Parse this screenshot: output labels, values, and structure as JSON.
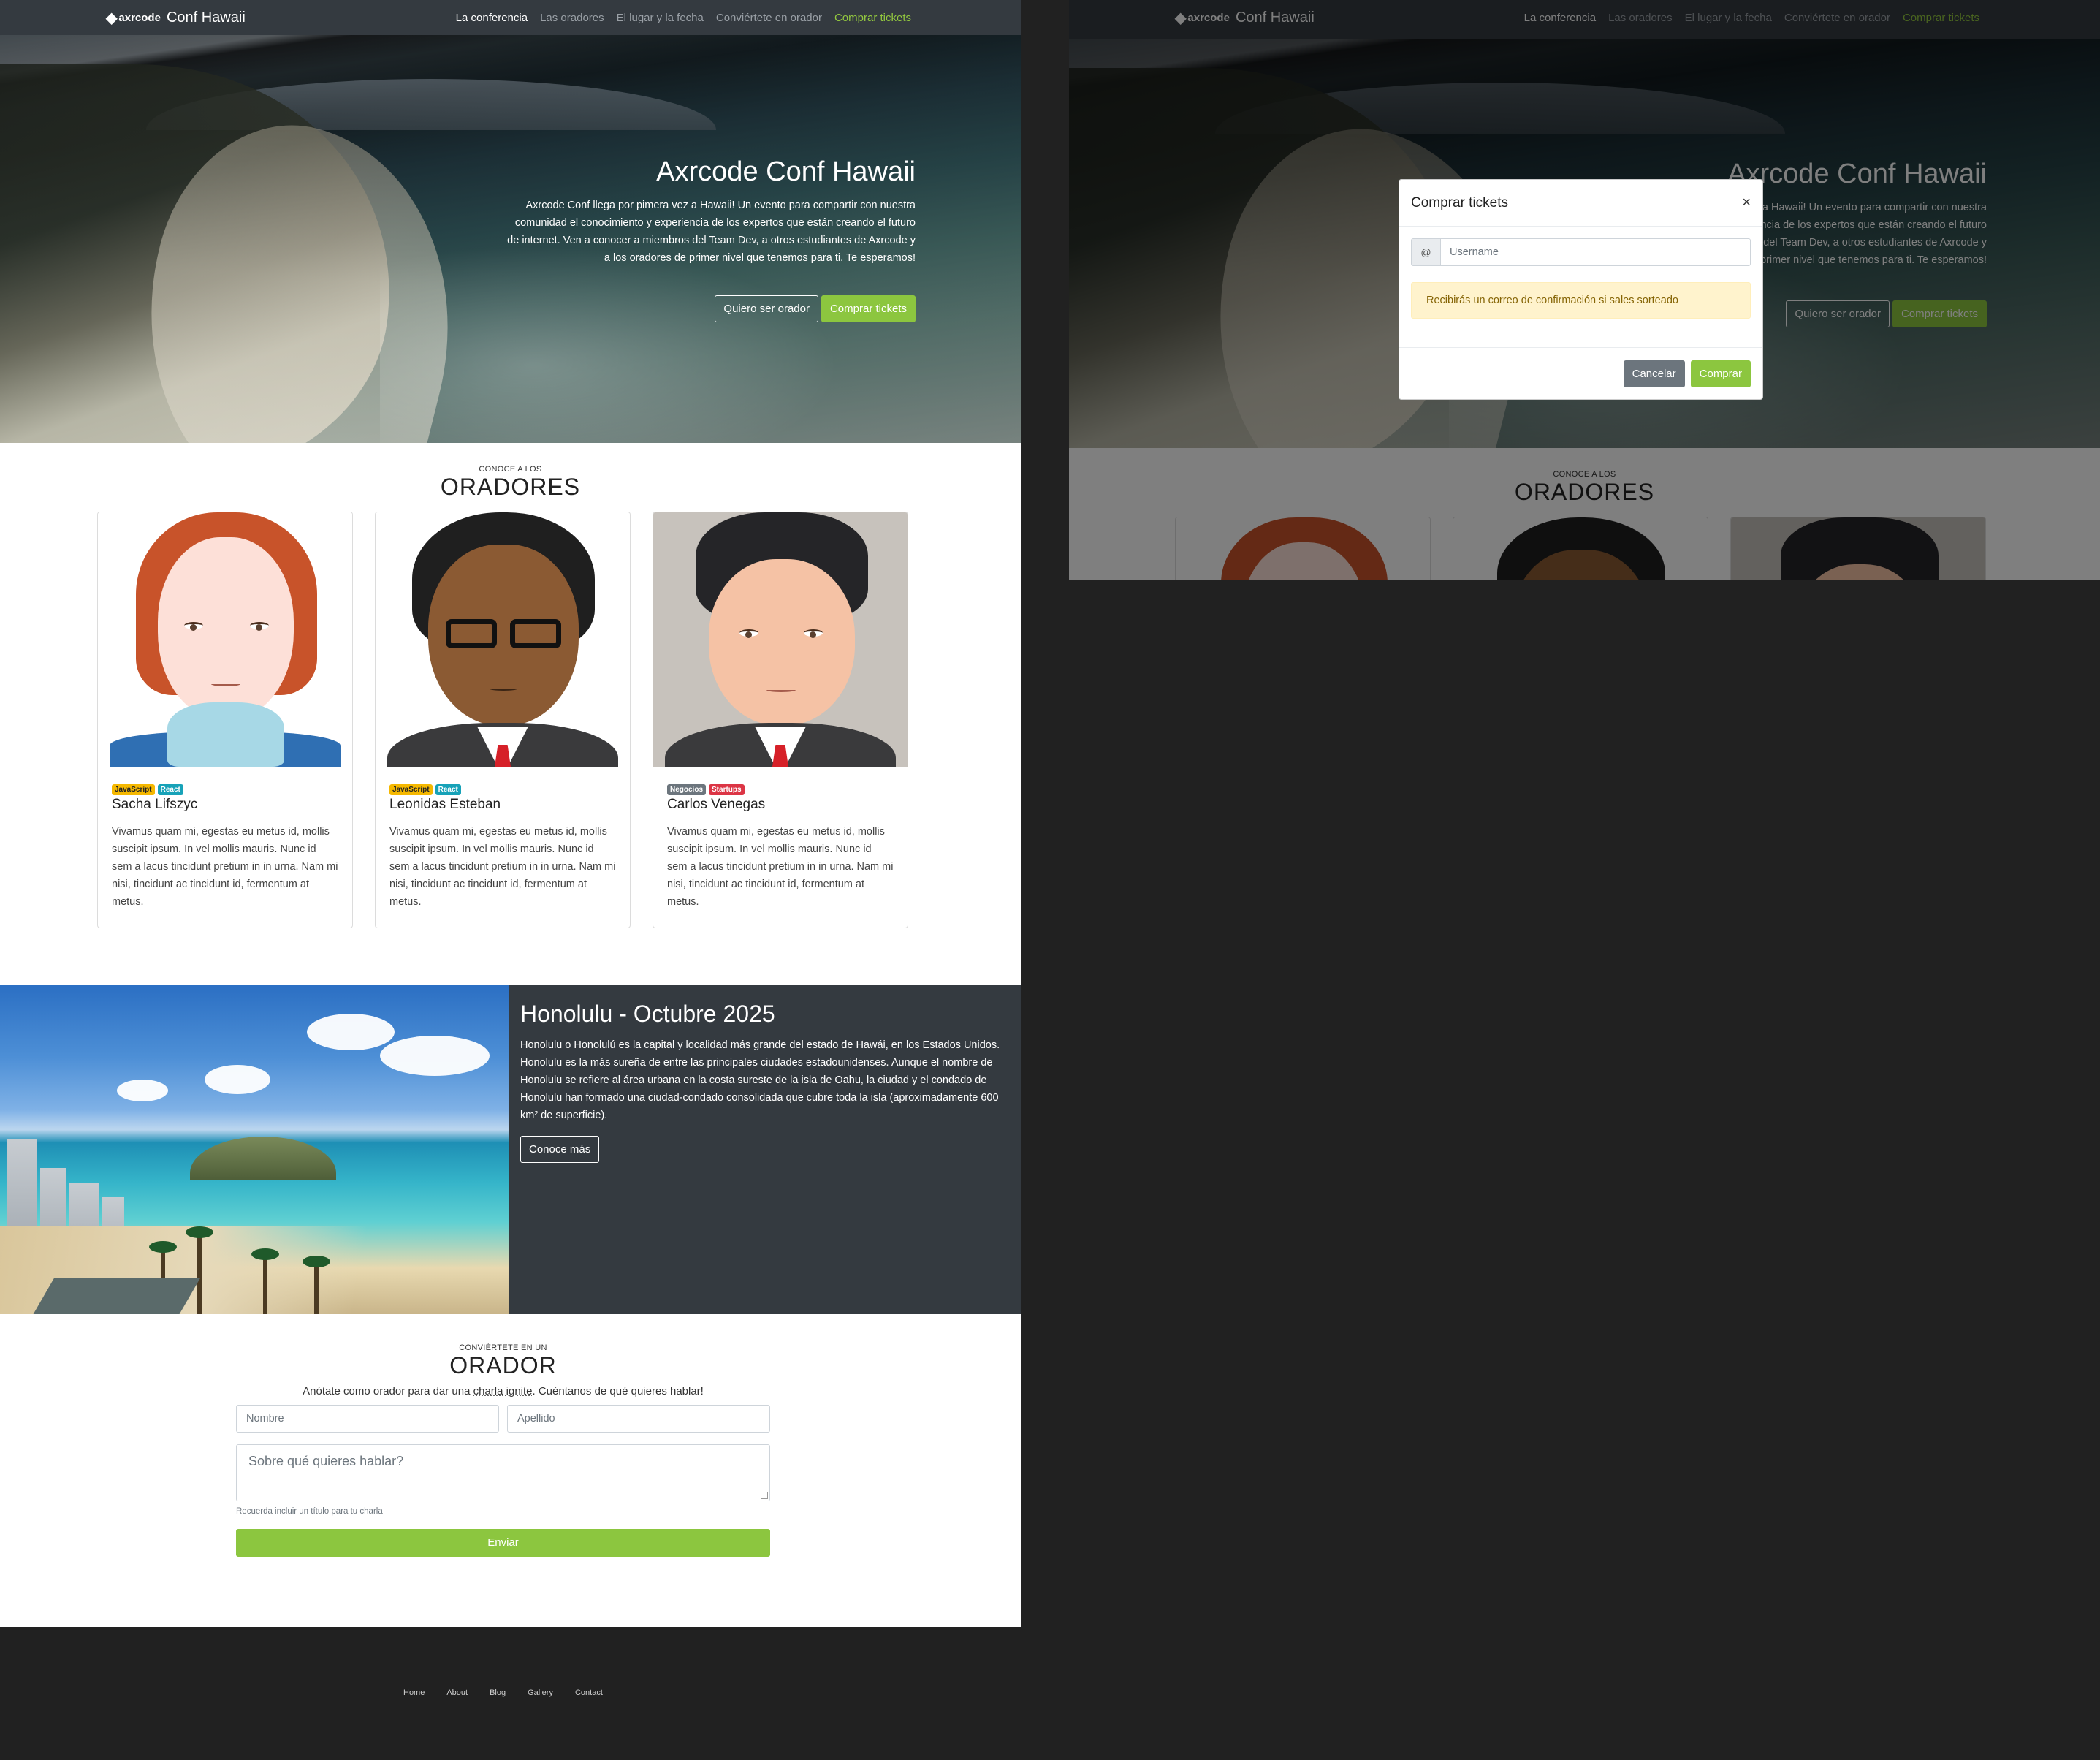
{
  "nav": {
    "brand_logo": "axrcode",
    "brand_title": "Conf Hawaii",
    "links": [
      "La conferencia",
      "Las oradores",
      "El lugar y la fecha",
      "Conviértete en orador",
      "Comprar tickets"
    ]
  },
  "hero": {
    "title": "Axrcode Conf Hawaii",
    "text": "Axrcode Conf llega por pimera vez a Hawaii! Un evento para compartir con nuestra comunidad el conocimiento y experiencia de los expertos que están creando el futuro de internet. Ven a conocer a miembros del Team Dev, a otros estudiantes de Axrcode y a los oradores de primer nivel que tenemos para ti. Te esperamos!",
    "btn_speaker": "Quiero ser orador",
    "btn_tickets": "Comprar tickets"
  },
  "speakers": {
    "kicker": "CONOCE A LOS",
    "title": "ORADORES",
    "cards": [
      {
        "badges": [
          "JavaScript",
          "React"
        ],
        "name": "Sacha Lifszyc",
        "text": "Vivamus quam mi, egestas eu metus id, mollis suscipit ipsum. In vel mollis mauris. Nunc id sem a lacus tincidunt pretium in in urna. Nam mi nisi, tincidunt ac tincidunt id, fermentum at metus."
      },
      {
        "badges": [
          "JavaScript",
          "React"
        ],
        "name": "Leonidas Esteban",
        "text": "Vivamus quam mi, egestas eu metus id, mollis suscipit ipsum. In vel mollis mauris. Nunc id sem a lacus tincidunt pretium in in urna. Nam mi nisi, tincidunt ac tincidunt id, fermentum at metus."
      },
      {
        "badges": [
          "Negocios",
          "Startups"
        ],
        "name": "Carlos Venegas",
        "text": "Vivamus quam mi, egestas eu metus id, mollis suscipit ipsum. In vel mollis mauris. Nunc id sem a lacus tincidunt pretium in in urna. Nam mi nisi, tincidunt ac tincidunt id, fermentum at metus."
      }
    ]
  },
  "venue": {
    "title": "Honolulu - Octubre 2025",
    "text": "Honolulu o Honolulú es la capital y localidad más grande del estado de Hawái, en los Estados Unidos. Honolulu es la más sureña de entre las principales ciudades estadounidenses. Aunque el nombre de Honolulu se refiere al área urbana en la costa sureste de la isla de Oahu, la ciudad y el condado de Honolulu han formado una ciudad-condado consolidada que cubre toda la isla (aproximadamente 600 km² de superficie).",
    "button": "Conoce más"
  },
  "speaker_form": {
    "kicker": "CONVIÉRTETE EN UN",
    "title": "ORADOR",
    "lead_before": "Anótate como orador para dar una ",
    "lead_underlined": "charla ignite",
    "lead_after": ". Cuéntanos de qué quieres hablar!",
    "first_name_placeholder": "Nombre",
    "last_name_placeholder": "Apellido",
    "topic_placeholder": "Sobre qué quieres hablar?",
    "hint": "Recuerda incluir un título para tu charla",
    "submit": "Enviar"
  },
  "footer": {
    "links": [
      "Home",
      "About",
      "Blog",
      "Gallery",
      "Contact"
    ]
  },
  "modal": {
    "title": "Comprar tickets",
    "close": "×",
    "addon": "@",
    "username_placeholder": "Username",
    "alert": "Recibirás un correo de confirmación si sales sorteado",
    "cancel": "Cancelar",
    "buy": "Comprar"
  },
  "colors": {
    "accent_green": "#8cc63f",
    "nav_dark": "#343a40",
    "badge_js": "#f5b800",
    "badge_react": "#17a2b8",
    "badge_business": "#6c757d",
    "badge_startups": "#dc3545"
  }
}
